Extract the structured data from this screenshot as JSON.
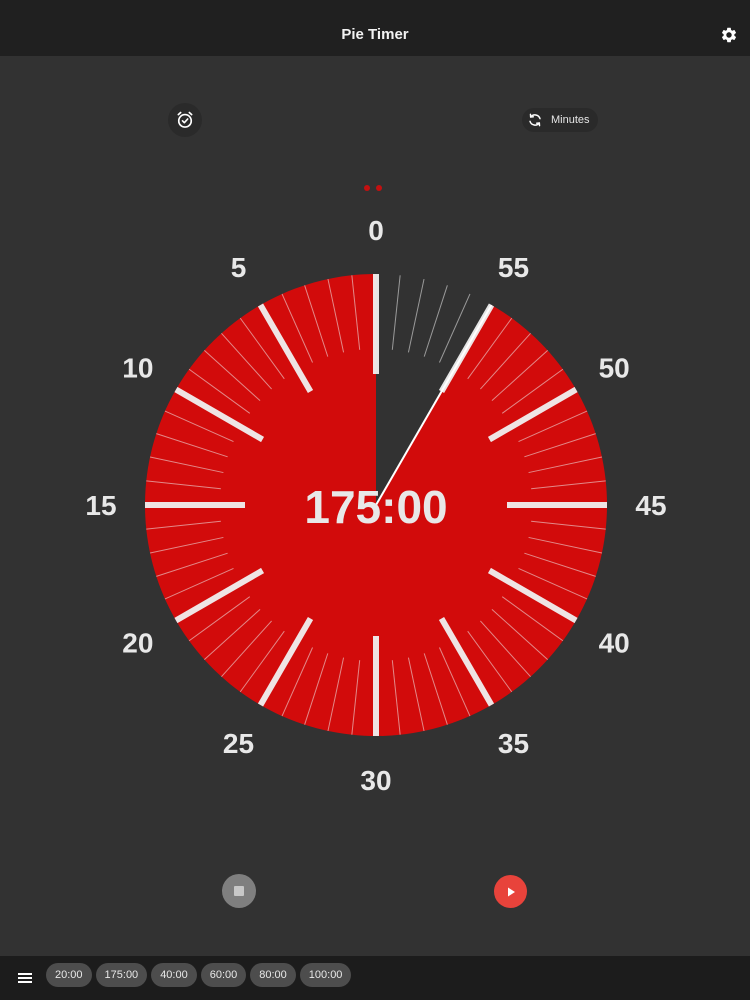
{
  "header": {
    "title": "Pie Timer",
    "settings_icon": "gear-icon"
  },
  "controls": {
    "alarm_icon": "alarm-clock-icon",
    "mode_icon": "refresh-icon",
    "mode_label": "Minutes"
  },
  "pager": {
    "dots": 2
  },
  "timer": {
    "display": "175:00",
    "dial_labels": [
      "0",
      "55",
      "50",
      "45",
      "40",
      "35",
      "30",
      "25",
      "20",
      "15",
      "10",
      "5"
    ],
    "dial_max_minutes": 60,
    "remaining_on_dial_minutes": 55,
    "colors": {
      "pie": "#d20b0b",
      "background": "#323232",
      "labels": "#e8e8e8",
      "ticks": "#f0f0f0"
    }
  },
  "playback": {
    "stop_icon": "stop-icon",
    "play_icon": "play-icon",
    "play_color": "#e8433b"
  },
  "bottom_bar": {
    "menu_icon": "hamburger-menu-icon",
    "presets": [
      "20:00",
      "175:00",
      "40:00",
      "60:00",
      "80:00",
      "100:00"
    ]
  }
}
